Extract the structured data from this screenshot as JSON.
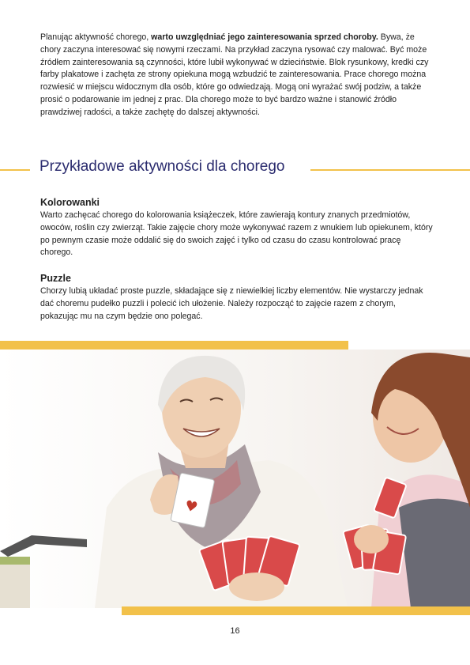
{
  "intro": {
    "line1_a": "Planując aktywność chorego, ",
    "line1_b": "warto uwzględniać jego zainteresowania sprzed choroby.",
    "line1_c": " Bywa,",
    "rest": "że chory zaczyna interesować się nowymi rzeczami. Na przykład zaczyna rysować czy malować. Być może źródłem zainteresowania są czynności, które lubił wykonywać w dzieciństwie. Blok rysunkowy, kredki czy farby plakatowe i zachęta ze strony opiekuna mogą wzbudzić te zainteresowania. Prace chorego można rozwiesić w miejscu widocznym dla osób, które go odwiedzają. Mogą oni wyrażać swój podziw, a także prosić o podarowanie im jednej z prac. Dla chorego może to być bardzo ważne i stanowić źródło prawdziwej radości, a także zachętę do dalszej aktywności."
  },
  "section": {
    "title": "Przykładowe aktywności dla chorego"
  },
  "activities": [
    {
      "title": "Kolorowanki",
      "text": "Warto zachęcać chorego do kolorowania książeczek, które zawierają kontury znanych przedmiotów, owoców, roślin czy zwierząt. Takie zajęcie chory może wykonywać razem z wnukiem lub opiekunem, który po pewnym czasie może oddalić się do swoich zajęć i tylko od czasu do czasu kontrolować pracę chorego."
    },
    {
      "title": "Puzzle",
      "text": "Chorzy lubią układać proste puzzle, składające się z niewielkiej liczby elementów. Nie wystarczy jednak dać choremu pudełko puzzli i polecić ich ułożenie. Należy rozpocząć to zajęcie razem z chorym, pokazując mu na czym będzie ono polegać."
    }
  ],
  "photo": {
    "icon": "photo-elderly-woman-playing-cards"
  },
  "colors": {
    "accent": "#f2c14a",
    "heading": "#2a2b6e"
  },
  "footer": {
    "page_number": "16"
  }
}
